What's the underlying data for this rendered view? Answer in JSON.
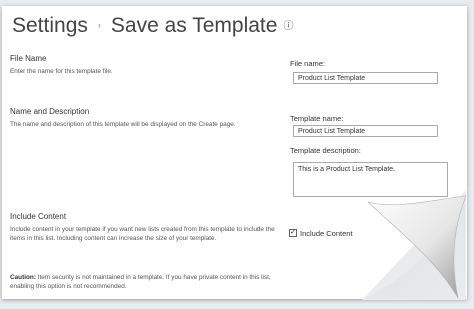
{
  "header": {
    "title": "Settings",
    "separator": "›",
    "subtitle": "Save as Template",
    "info_icon": "ⓘ"
  },
  "file_name_section": {
    "heading": "File Name",
    "description": "Enter the name for this template file.",
    "field_label": "File name:",
    "field_value": "Product List Template"
  },
  "name_desc_section": {
    "heading": "Name and Description",
    "description": "The name and description of this template will be displayed on the Create page.",
    "name_label": "Template name:",
    "name_value": "Product List Template",
    "desc_label": "Template description:",
    "desc_value": "This is a Product List Template."
  },
  "content_section": {
    "heading": "Include Content",
    "description": "Include content in your template if you want new lists created from this template to include the items in this list. Including content can increase the size of your template.",
    "checkbox_label": "Include Content",
    "checkbox_checked": true,
    "caution_label": "Caution:",
    "caution_text": " Item security is not maintained in a template. If you have private content in this list, enabling this option is not recommended."
  }
}
